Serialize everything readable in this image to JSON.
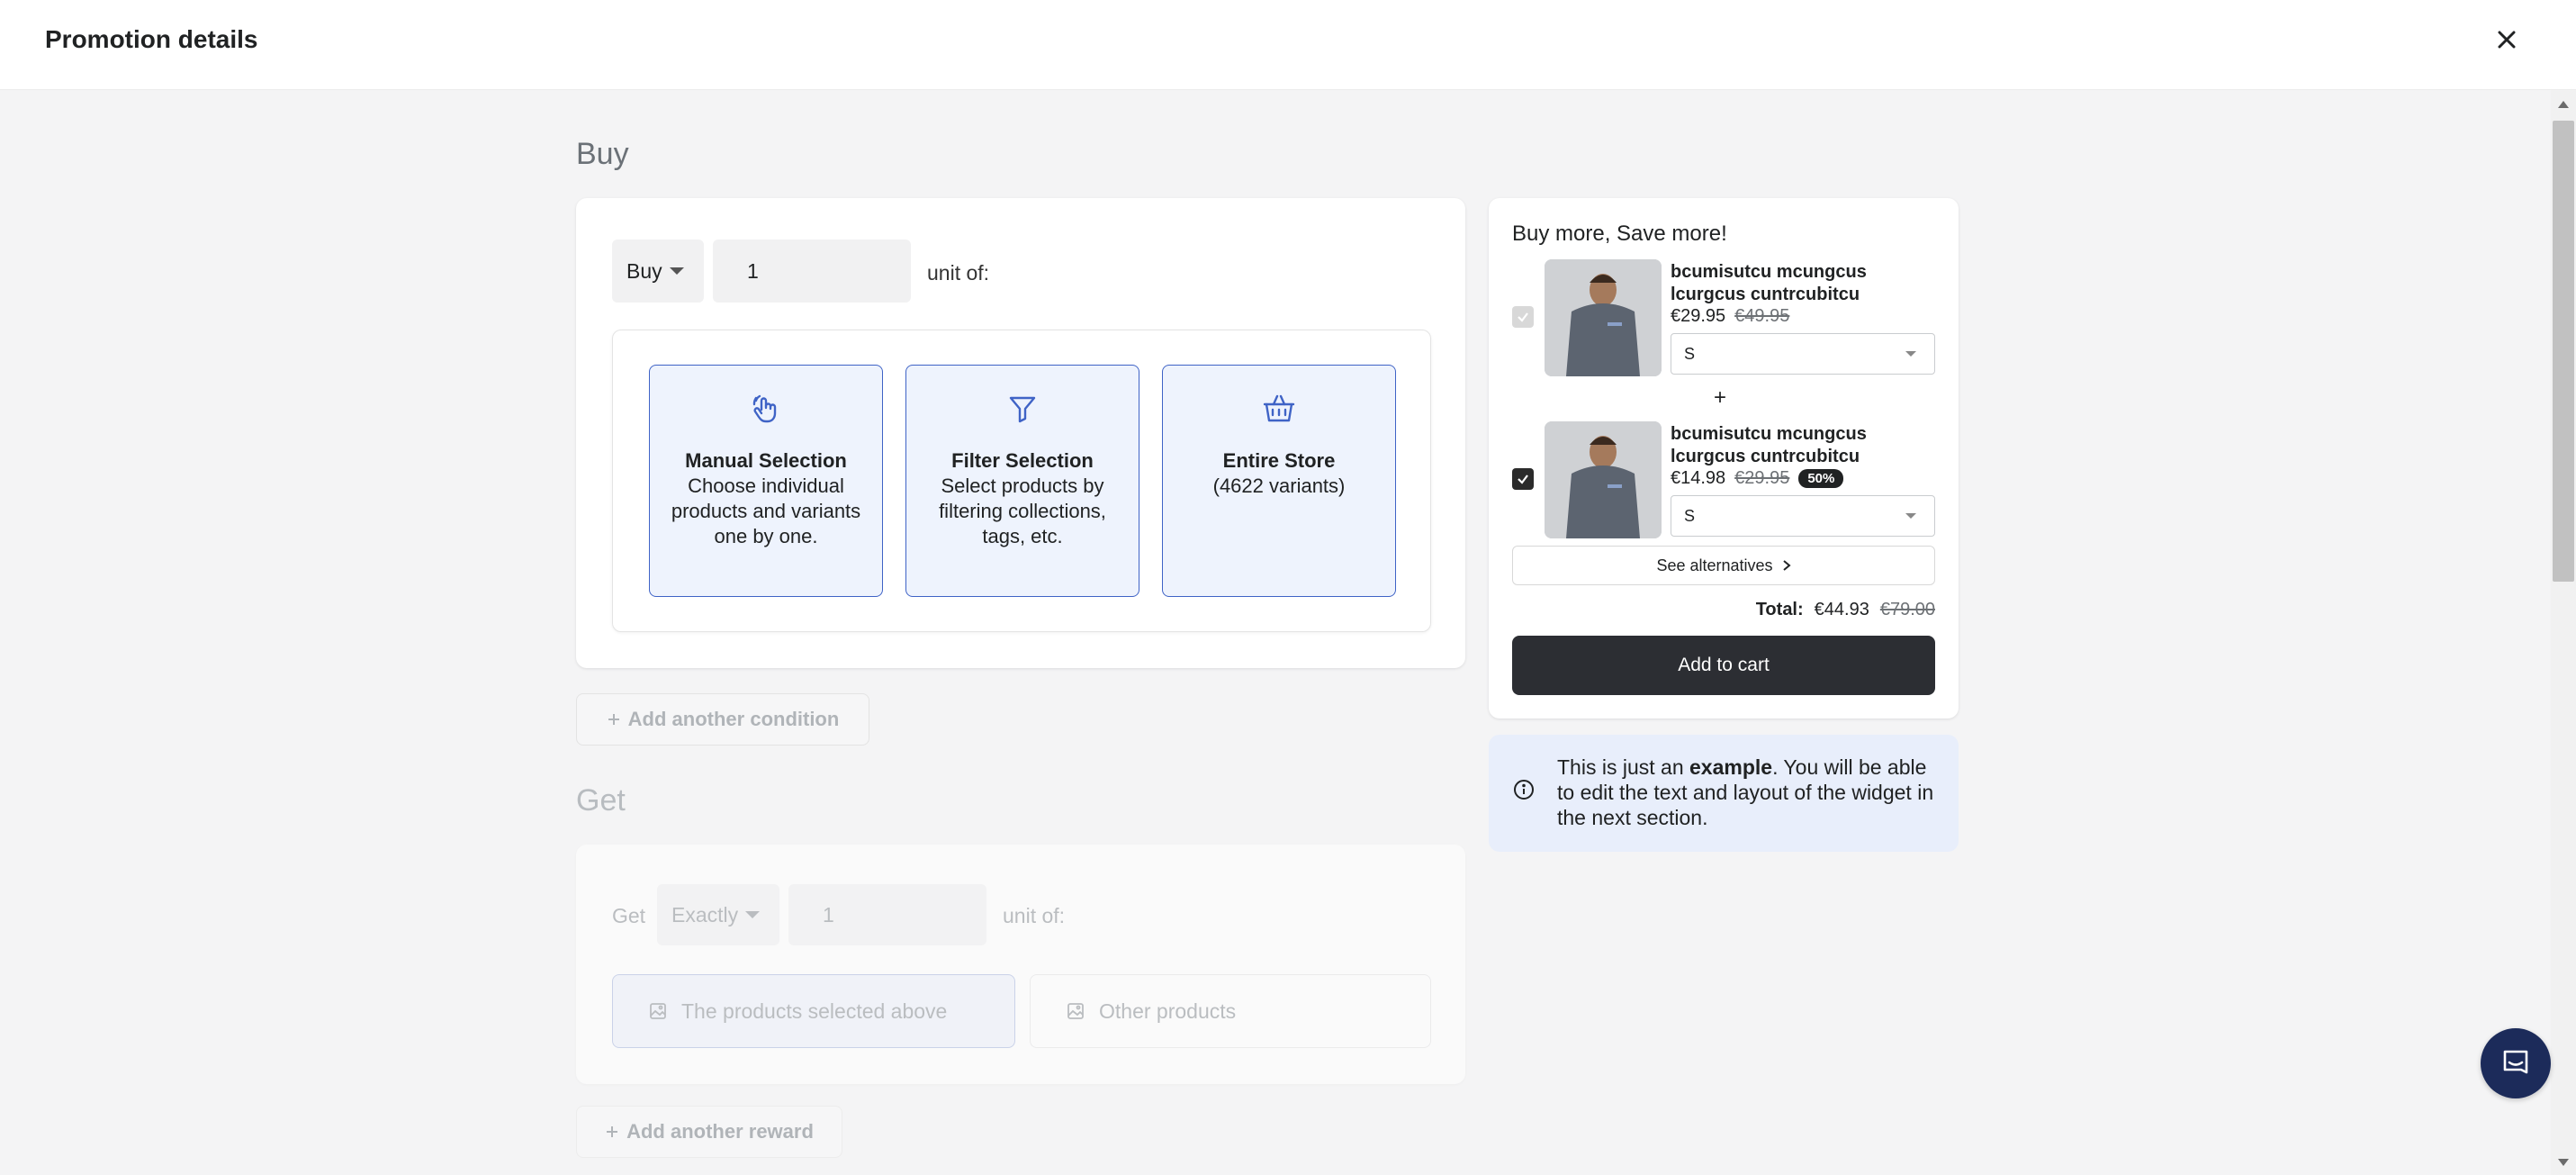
{
  "header": {
    "title": "Promotion details"
  },
  "buy": {
    "section_title": "Buy",
    "mode_select": "Buy",
    "quantity": "1",
    "unit_label": "unit of:",
    "options": [
      {
        "title": "Manual Selection",
        "desc": "Choose individual products and variants one by one."
      },
      {
        "title": "Filter Selection",
        "desc": "Select products by filtering collections, tags, etc."
      },
      {
        "title": "Entire Store",
        "desc": "(4622 variants)"
      }
    ],
    "add_condition": "Add another condition"
  },
  "get": {
    "section_title": "Get",
    "label": "Get",
    "mode_select": "Exactly",
    "quantity": "1",
    "unit_label": "unit of:",
    "option_selected": "The products selected above",
    "option_other": "Other products",
    "add_reward": "Add another reward"
  },
  "widget": {
    "title": "Buy more, Save more!",
    "products": [
      {
        "name": "bcumisutcu mcungcus lcurgcus cuntrcubitcu",
        "price": "€29.95",
        "compare_price": "€49.95",
        "badge": "",
        "variant": "S",
        "checked": true,
        "disabled": true
      },
      {
        "name": "bcumisutcu mcungcus lcurgcus cuntrcubitcu",
        "price": "€14.98",
        "compare_price": "€29.95",
        "badge": "50%",
        "variant": "S",
        "checked": true,
        "disabled": false
      }
    ],
    "plus": "+",
    "see_alternatives": "See alternatives",
    "total_label": "Total:",
    "total_price": "€44.93",
    "total_compare": "€79.00",
    "add_to_cart": "Add to cart"
  },
  "info": {
    "text_before": "This is just an ",
    "text_bold": "example",
    "text_after": ". You will be able to edit the text and layout of the widget in the next section."
  },
  "colors": {
    "accent": "#3f63c6",
    "card_selected_bg": "#eef3fd",
    "cart_button": "#2c2e33",
    "chat_button": "#1c2b5a",
    "info_bg": "#e8eefb"
  },
  "icons": [
    "close-icon",
    "touch-icon",
    "filter-icon",
    "basket-icon",
    "plus-icon",
    "image-icon",
    "chevron-right-icon",
    "info-icon",
    "chat-icon"
  ]
}
